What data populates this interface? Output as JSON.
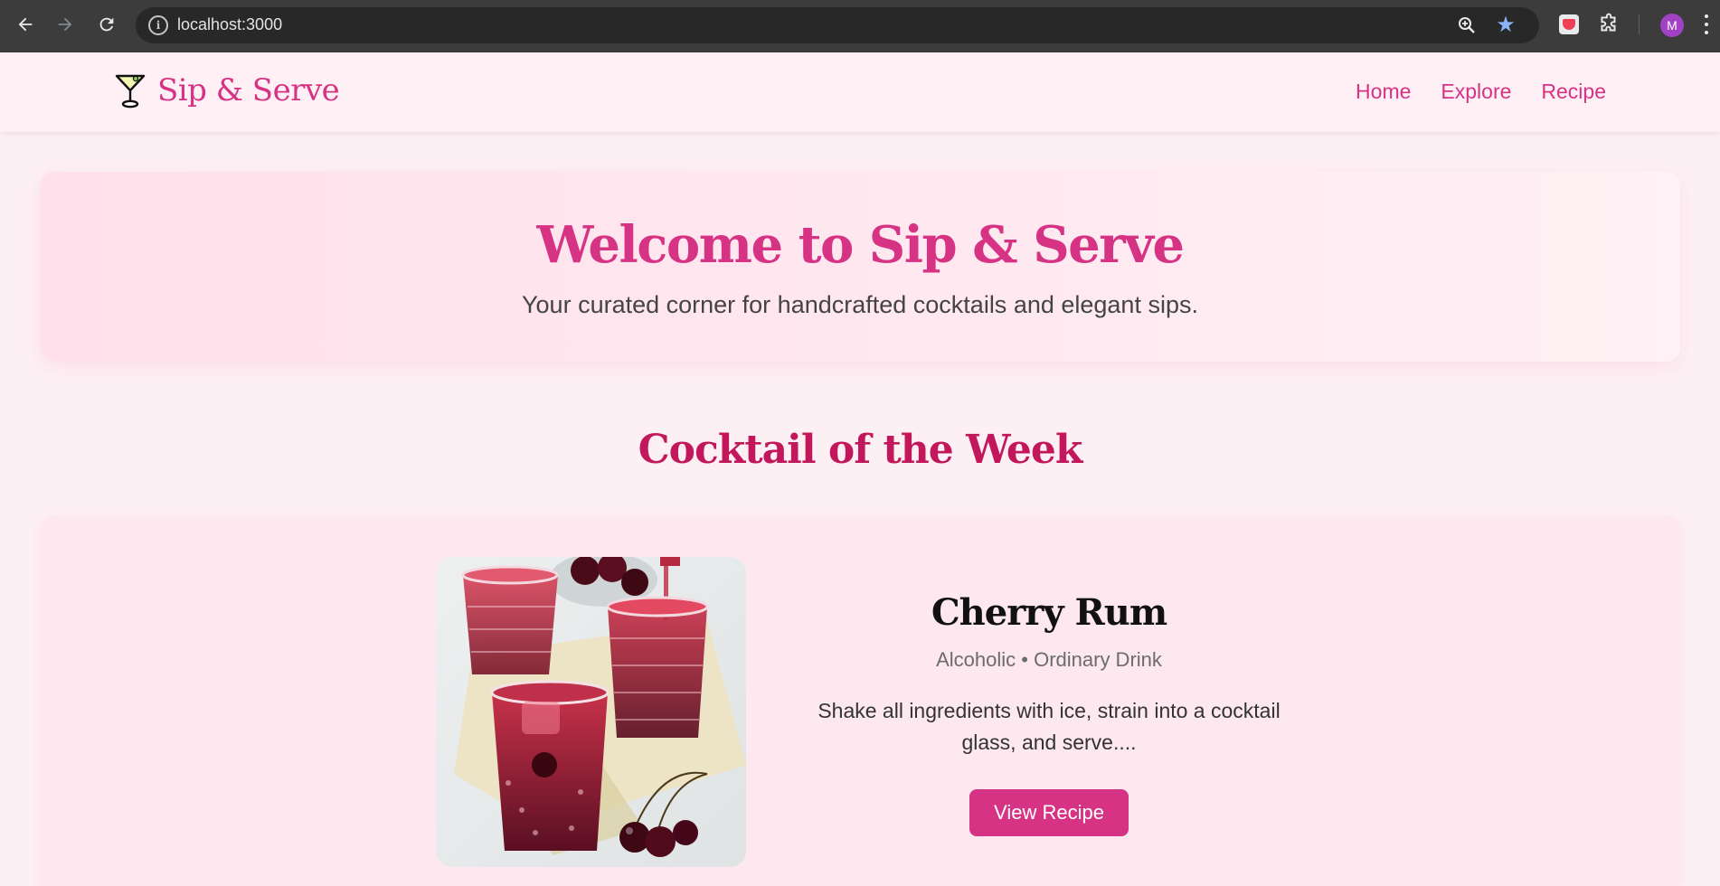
{
  "browser": {
    "url": "localhost:3000",
    "profile_initial": "M",
    "icons": [
      "back-arrow-icon",
      "forward-arrow-icon",
      "reload-icon",
      "site-info-icon",
      "zoom-icon",
      "bookmark-star-icon",
      "pocket-extension-icon",
      "extensions-puzzle-icon",
      "kebab-menu-icon"
    ]
  },
  "nav": {
    "brand": "Sip & Serve",
    "brand_icon": "martini-glass-icon",
    "links": [
      "Home",
      "Explore",
      "Recipe"
    ]
  },
  "hero": {
    "title": "Welcome to Sip & Serve",
    "subtitle": "Your curated corner for handcrafted cocktails and elegant sips."
  },
  "feature": {
    "section_title": "Cocktail of the Week",
    "name": "Cherry Rum",
    "meta": "Alcoholic • Ordinary Drink",
    "description": "Shake all ingredients with ice, strain into a cocktail glass, and serve....",
    "button": "View Recipe"
  },
  "colors": {
    "accent": "#d63384",
    "section_title": "#c2185b",
    "page_bg": "#fdf0f4",
    "chrome_bg": "#3c3c3c"
  }
}
